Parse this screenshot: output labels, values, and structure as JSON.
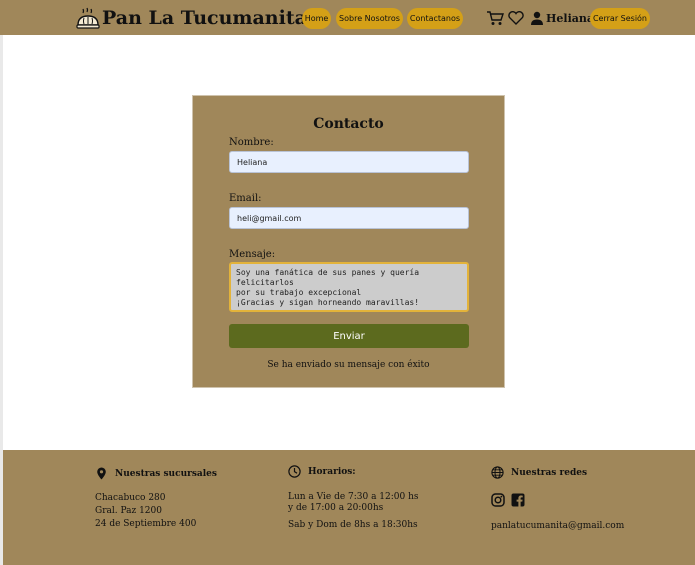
{
  "header": {
    "brand": "Pan La Tucumanita",
    "nav": [
      {
        "label": "Home"
      },
      {
        "label": "Sobre Nosotros"
      },
      {
        "label": "Contactanos"
      }
    ],
    "user_name": "Heliana",
    "logout_label": "Cerrar Sesión",
    "icons": [
      "bread-basket-icon",
      "cart-icon",
      "heart-icon",
      "user-icon"
    ]
  },
  "contact_form": {
    "title": "Contacto",
    "name_label": "Nombre:",
    "name_value": "Heliana",
    "email_label": "Email:",
    "email_value": "heli@gmail.com",
    "message_label": "Mensaje:",
    "message_value": "Soy una fanática de sus panes y quería felicitarlos\npor su trabajo excepcional\n¡Gracias y sigan horneando maravillas!",
    "submit_label": "Enviar",
    "success_message": "Se ha enviado su mensaje con éxito"
  },
  "footer": {
    "branches": {
      "title": "Nuestras sucursales",
      "lines": [
        "Chacabuco 280",
        "Gral. Paz 1200",
        "24 de Septiembre 400"
      ]
    },
    "hours": {
      "title": "Horarios:",
      "weekday_1": "Lun a Vie de 7:30 a 12:00 hs",
      "weekday_2": "y de 17:00 a 20:00hs",
      "weekend": "Sab y Dom de 8hs a 18:30hs"
    },
    "social": {
      "title": "Nuestras redes",
      "email": "panlatucumanita@gmail.com"
    }
  },
  "colors": {
    "header_bg": "#a0875a",
    "nav_button": "#d4a017",
    "submit_bg": "#5c6a1e",
    "input_bg": "#e8f0fe",
    "textarea_border": "#e3b33a"
  }
}
